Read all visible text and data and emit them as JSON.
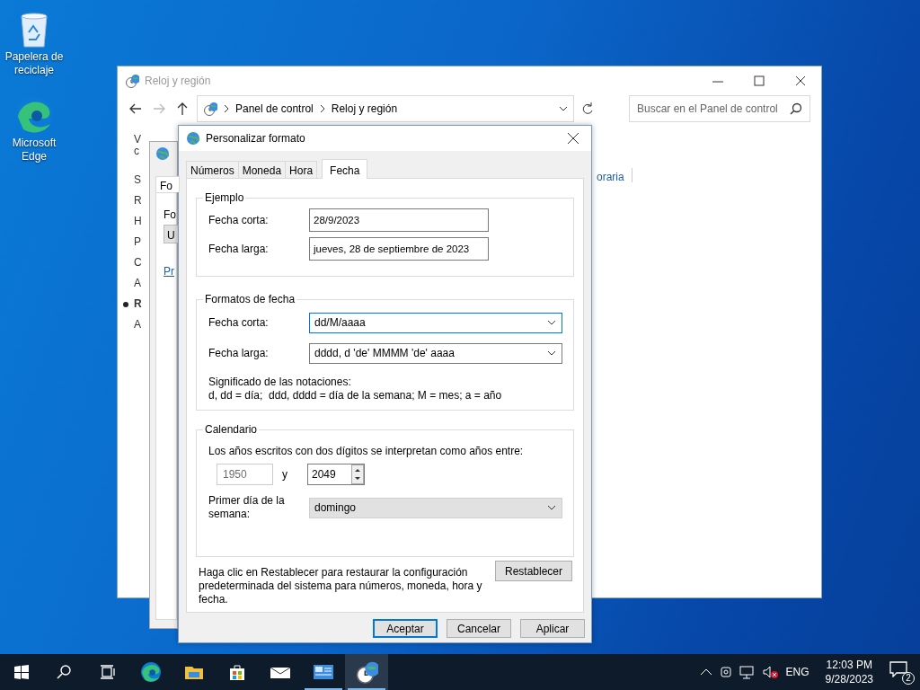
{
  "desktop_icons": [
    {
      "kind": "recycle",
      "label": "Papelera de reciclaje"
    },
    {
      "kind": "edge",
      "label": "Microsoft Edge"
    }
  ],
  "main_window": {
    "title": "Reloj y región",
    "breadcrumb": [
      "Panel de control",
      "Reloj y región"
    ],
    "search": {
      "placeholder": "Buscar en el Panel de control"
    },
    "side_fragments": [
      {
        "text": "V",
        "bold": false,
        "bullet": false
      },
      {
        "text": "c",
        "bold": false,
        "bullet": false
      },
      {
        "text": "S",
        "bold": false,
        "bullet": false
      },
      {
        "text": "R",
        "bold": false,
        "bullet": false
      },
      {
        "text": "H",
        "bold": false,
        "bullet": false
      },
      {
        "text": "P",
        "bold": false,
        "bullet": false
      },
      {
        "text": "C",
        "bold": false,
        "bullet": false
      },
      {
        "text": "A",
        "bold": false,
        "bullet": false
      },
      {
        "text": "R",
        "bold": true,
        "bullet": true
      },
      {
        "text": "A",
        "bold": false,
        "bullet": false
      }
    ],
    "link_fragment": "oraria"
  },
  "region_dialog": {
    "tab": "Fo",
    "label": "Fo",
    "dropdown": "U",
    "link": "Pr"
  },
  "dialog": {
    "title": "Personalizar formato",
    "tabs": [
      {
        "label": "Números",
        "selected": false
      },
      {
        "label": "Moneda",
        "selected": false
      },
      {
        "label": "Hora",
        "selected": false
      },
      {
        "label": "Fecha",
        "selected": true
      }
    ],
    "example": {
      "legend": "Ejemplo",
      "rows": [
        {
          "label": "Fecha corta:",
          "value": "28/9/2023"
        },
        {
          "label": "Fecha larga:",
          "value": "jueves, 28 de septiembre de 2023"
        }
      ]
    },
    "formats": {
      "legend": "Formatos de fecha",
      "rows": [
        {
          "label": "Fecha corta:",
          "value": "dd/M/aaaa",
          "focused": true
        },
        {
          "label": "Fecha larga:",
          "value": "dddd, d 'de' MMMM 'de' aaaa",
          "focused": false
        }
      ],
      "notes_title": "Significado de las notaciones:",
      "notes": "d, dd = día;  ddd, dddd = día de la semana; M = mes; a = año"
    },
    "calendar": {
      "legend": "Calendario",
      "intro": "Los años escritos con dos dígitos se interpretan como años entre:",
      "year_from": {
        "value": "1950",
        "disabled": true
      },
      "and": "y",
      "year_to": {
        "value": "2049",
        "disabled": false
      },
      "first_day_label": "Primer día de la semana:",
      "first_day": "domingo"
    },
    "reset_text": "Haga clic en Restablecer para restaurar la configuración predeterminada del sistema para números, moneda, hora y fecha.",
    "reset_button": "Restablecer",
    "buttons": [
      {
        "label": "Aceptar",
        "default": true
      },
      {
        "label": "Cancelar",
        "default": false
      },
      {
        "label": "Aplicar",
        "default": false
      }
    ]
  },
  "taskbar": {
    "apps": [
      {
        "kind": "edge",
        "selected": false,
        "running": false
      },
      {
        "kind": "folder",
        "selected": false,
        "running": false
      },
      {
        "kind": "store",
        "selected": false,
        "running": false
      },
      {
        "kind": "mail",
        "selected": false,
        "running": false
      },
      {
        "kind": "app",
        "selected": false,
        "running": true
      },
      {
        "kind": "clock",
        "selected": true,
        "running": true
      }
    ],
    "language": "ENG",
    "time": "12:03 PM",
    "date": "9/28/2023",
    "notifications": "2"
  }
}
